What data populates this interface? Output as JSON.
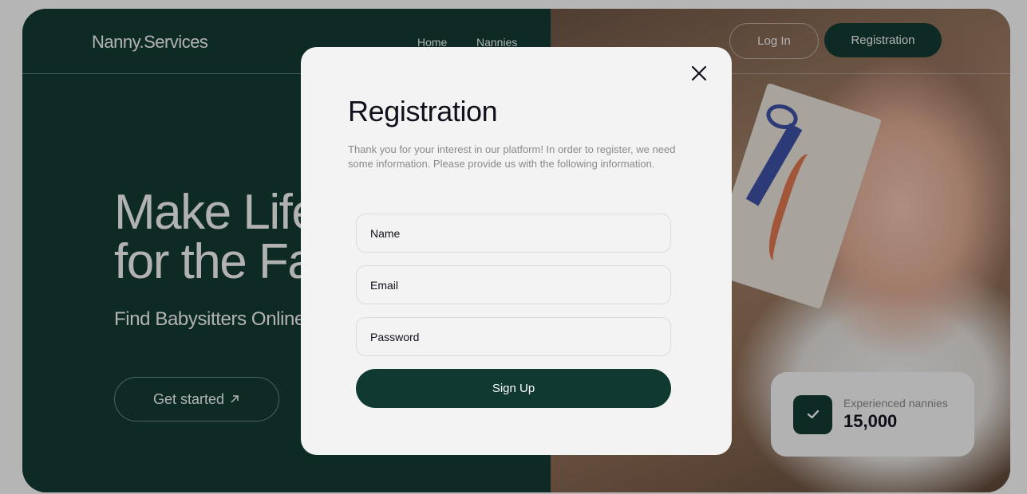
{
  "header": {
    "logo": "Nanny.Services",
    "nav": [
      "Home",
      "Nannies"
    ],
    "login_label": "Log In",
    "registration_label": "Registration"
  },
  "hero": {
    "title_line1": "Make Life Easier",
    "title_line2": "for the Family:",
    "subtitle": "Find Babysitters Online for All Needs",
    "cta_label": "Get started",
    "cta_icon": "arrow-up-right-icon"
  },
  "stat": {
    "icon": "check-icon",
    "label": "Experienced nannies",
    "value": "15,000"
  },
  "modal": {
    "title": "Registration",
    "description": "Thank you for your interest in our platform! In order to register, we need some information. Please provide us with the following information.",
    "fields": {
      "name_placeholder": "Name",
      "email_placeholder": "Email",
      "password_placeholder": "Password"
    },
    "submit_label": "Sign Up",
    "close_icon": "close-icon"
  },
  "colors": {
    "primary_green": "#103931",
    "background_light": "#f3f3f3",
    "text_dark": "#11101c",
    "text_muted": "#8a8a89"
  }
}
